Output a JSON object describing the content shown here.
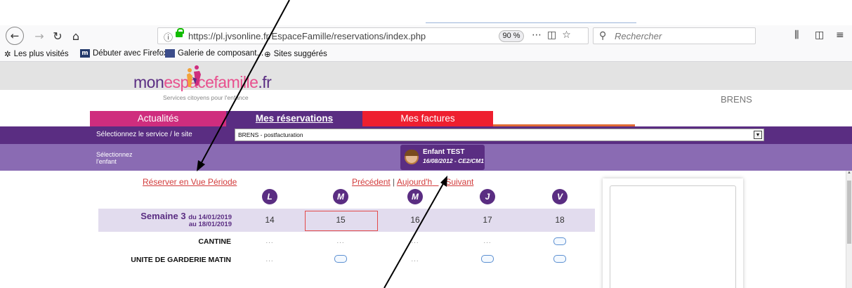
{
  "browser": {
    "url": "https://pl.jvsonline.fr/EspaceFamille/reservations/index.php",
    "zoom": "90 %",
    "search_placeholder": "Rechercher",
    "icons": [
      "back-icon",
      "forward-icon",
      "reload-icon",
      "home-icon",
      "info-icon",
      "lock-icon",
      "more-icon",
      "pocket-icon",
      "star-icon",
      "search-icon",
      "library-icon",
      "sidebar-icon",
      "menu-icon"
    ]
  },
  "bookmarks": [
    {
      "label": "Les plus visités",
      "icon": "gear-icon"
    },
    {
      "label": "Débuter avec Firefox",
      "icon": "m-icon"
    },
    {
      "label": "Galerie de composant...",
      "icon": "gallery-icon"
    },
    {
      "label": "Sites suggérés",
      "icon": "globe-icon"
    }
  ],
  "site": {
    "logo_part1": "mon",
    "logo_part2": "espacefamille",
    "logo_part3": ".fr",
    "tagline": "Services citoyens pour l'enfance",
    "commune": "BRENS"
  },
  "tabs": [
    {
      "label": "Actualités",
      "color": "#cf2d7e"
    },
    {
      "label": "Mes réservations",
      "color": "#5a2d82",
      "active": true
    },
    {
      "label": "Mes factures",
      "color": "#ee1f2f"
    }
  ],
  "service": {
    "label": "Sélectionnez le service / le site",
    "value": "BRENS - postfacturation"
  },
  "child": {
    "label": "Sélectionnez l'enfant",
    "name": "Enfant TEST",
    "info": "16/08/2012 - CE2/CM1"
  },
  "calendar": {
    "reserve_link": "Réserver en Vue Période",
    "prev": "Précédent",
    "sep": "|",
    "today_part1": "Aujourd'h",
    "today_part2": "ui",
    "today_part3": "Suivant",
    "today_sep": " | ",
    "days": [
      "L",
      "M",
      "M",
      "J",
      "V"
    ],
    "week_title": "Semaine 3",
    "week_from": "du 14/01/2019",
    "week_to": "au 18/01/2019",
    "dates": [
      "14",
      "15",
      "16",
      "17",
      "18"
    ],
    "today_index": 1,
    "services": [
      {
        "name": "CANTINE",
        "cells": [
          "...",
          "...",
          "...",
          "...",
          "pill"
        ]
      },
      {
        "name": "UNITE DE GARDERIE MATIN",
        "cells": [
          "...",
          "pill",
          "...",
          "pill",
          "pill"
        ]
      }
    ]
  },
  "colors": {
    "primary": "#5a2d82",
    "light_purple": "#8a6bb3",
    "pink": "#cf2d7e",
    "red": "#ee1f2f",
    "link": "#d23b3b"
  }
}
